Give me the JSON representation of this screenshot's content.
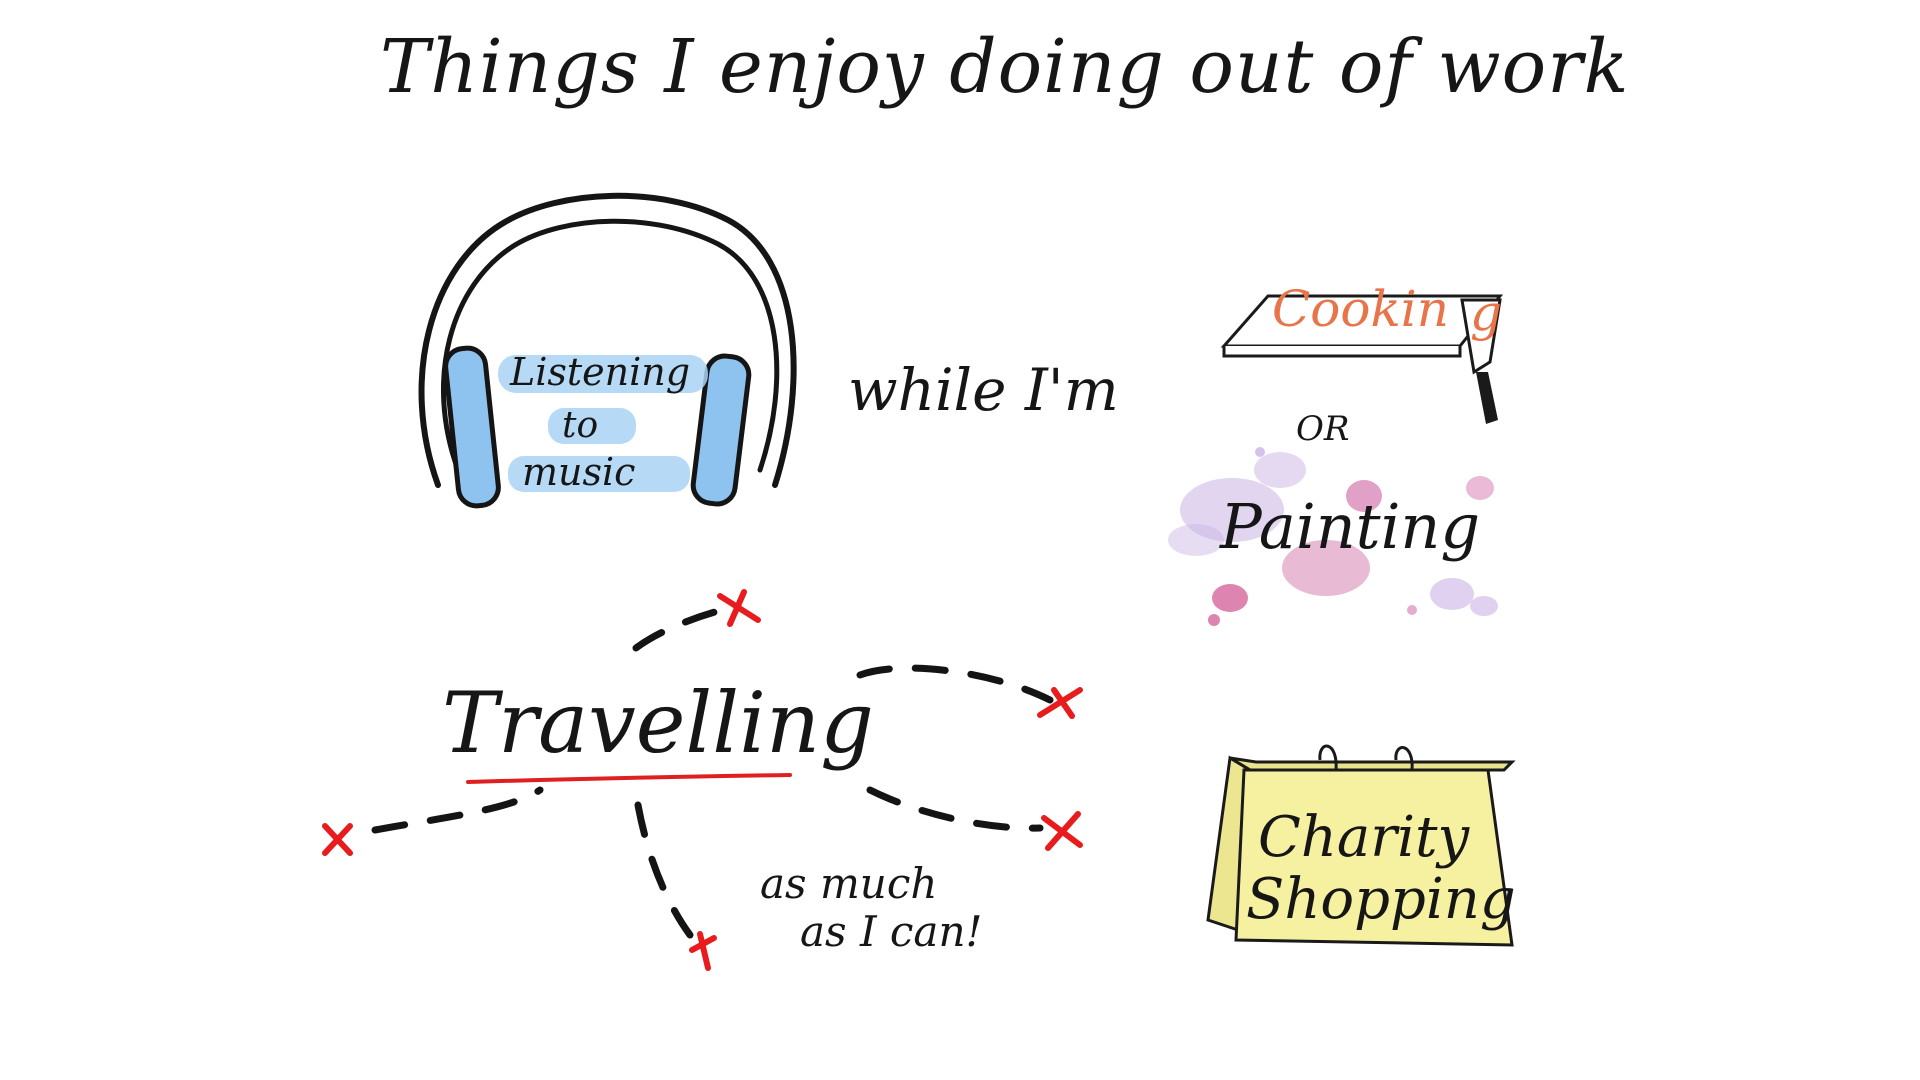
{
  "title": "Things I enjoy doing out of work",
  "music": {
    "label_lines": [
      "Listening",
      "to",
      "music"
    ],
    "icon": "headphones-icon",
    "accent": "#8ec3f0"
  },
  "connector": "while I'm",
  "cooking": {
    "label": "Cookin",
    "label_end": "g",
    "icon": "knife-chopping-board-icon",
    "color": "#e8744a"
  },
  "or_text": "OR",
  "painting": {
    "label": "Painting",
    "icon": "paint-splatter-icon",
    "splash_colors": [
      "#d998c5",
      "#c3a8e0",
      "#e8a4c8"
    ]
  },
  "travelling": {
    "label": "Travelling",
    "underline_color": "#e02020",
    "marker_icon": "x-mark-icon",
    "marker_color": "#e81c1c",
    "note_lines": [
      "as much",
      "as I can!"
    ]
  },
  "charity": {
    "label_lines": [
      "Charity",
      "Shopping"
    ],
    "icon": "shopping-bag-icon",
    "bag_color": "#f5f1a0"
  }
}
